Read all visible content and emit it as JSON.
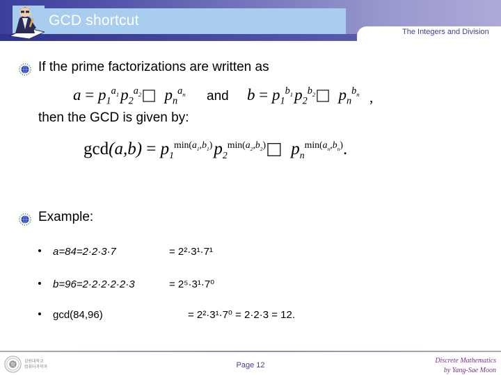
{
  "slide": {
    "title": "GCD shortcut",
    "section_tab": "The Integers and Division"
  },
  "body": {
    "intro_line": "If the prime factorizations are written as",
    "formula_a": {
      "lhs": "a =",
      "terms": [
        "p",
        "p",
        "p"
      ],
      "display": "a = p₁^{a₁} p₂^{a₂} ⋯ pₙ^{aₙ}"
    },
    "conjunction": "and",
    "formula_b": {
      "display": "b = p₁^{b₁} p₂^{b₂} ⋯ pₙ^{bₙ}"
    },
    "formula_b_trailing": ",",
    "then_line": "then the GCD is given by:",
    "formula_gcd": {
      "display": "gcd(a,b) = p₁^{min(a₁,b₁)} p₂^{min(a₂,b₂)} ⋯ pₙ^{min(aₙ,bₙ)}."
    },
    "example_heading": "Example:",
    "examples": [
      {
        "lhs": "a=84=2·2·3·7",
        "rhs": "= 2²·3¹·7¹"
      },
      {
        "lhs": "b=96=2·2·2·2·2·3",
        "rhs": "= 2⁵·3¹·7⁰"
      },
      {
        "lhs": "gcd(84,96)",
        "rhs": "= 2²·3¹·7⁰ = 2·2·3 = 12."
      }
    ]
  },
  "footer": {
    "page_label": "Page 12",
    "course_title": "Discrete Mathematics",
    "author_line": "by Yang-Sae Moon",
    "logo_line1": "강원대학교",
    "logo_line2": "컴퓨터과학과"
  },
  "icons": {
    "bullet": "globe-icon",
    "title": "writer-icon",
    "footer_seal": "university-seal-icon"
  },
  "colors": {
    "header_dark": "#3c3f9e",
    "title_bar": "#a8cdee",
    "tab_text": "#3b3f9c",
    "footer_accent": "#7b2f8e"
  }
}
